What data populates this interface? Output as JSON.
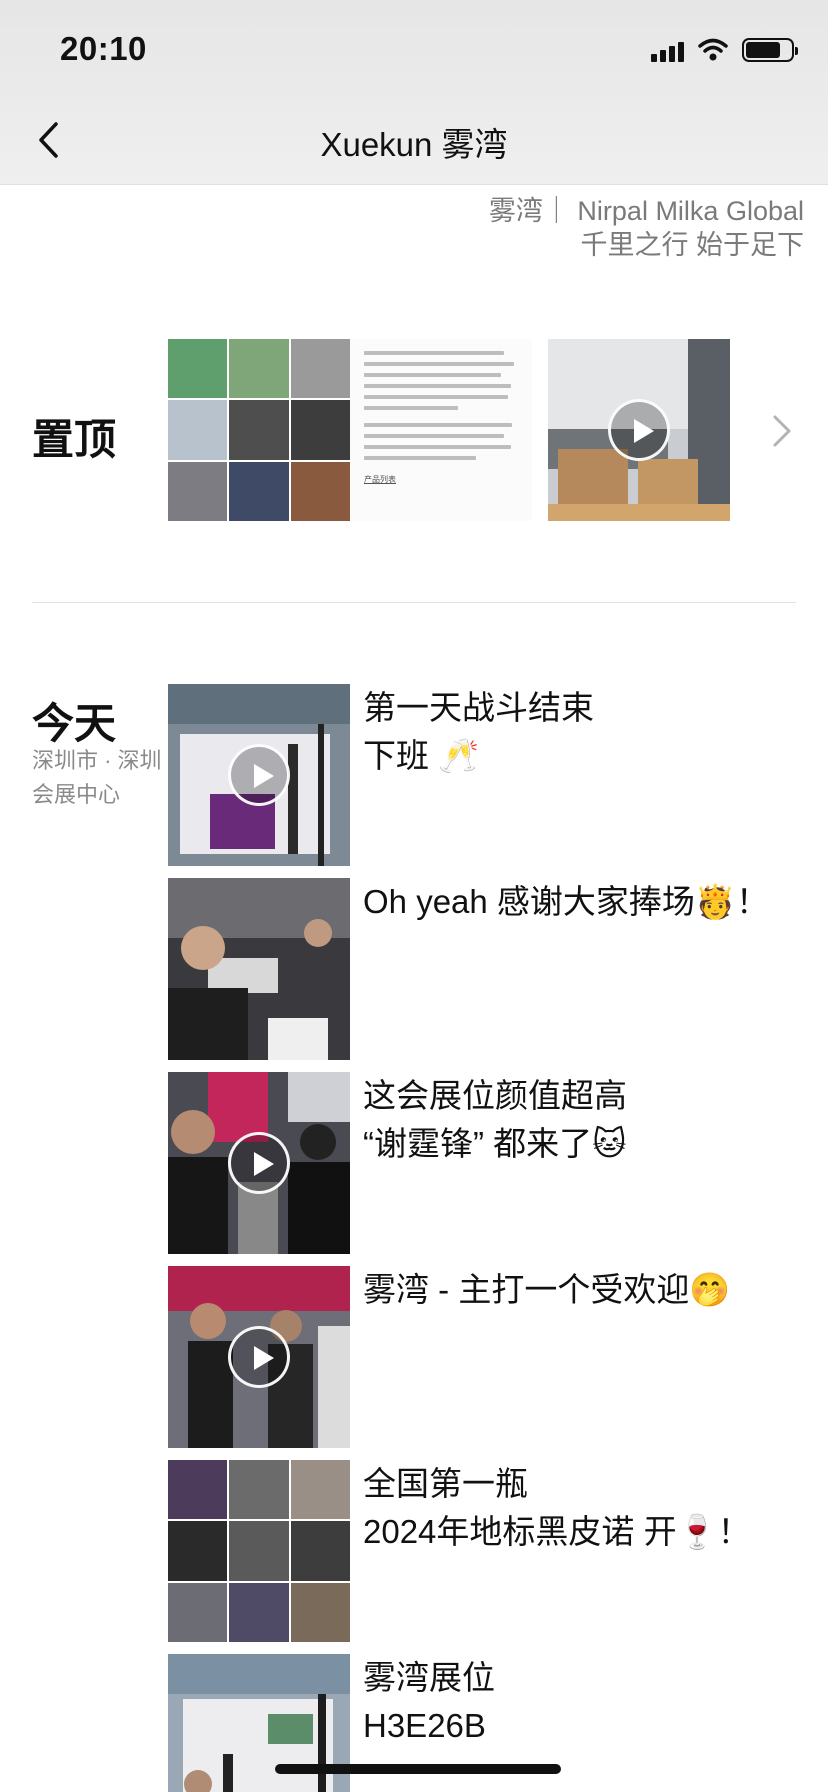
{
  "status_bar": {
    "time": "20:10"
  },
  "nav": {
    "title": "Xuekun 雾湾"
  },
  "signature": {
    "line1": "雾湾｜ Nirpal Milka Global",
    "line2": "千里之行 始于足下"
  },
  "pinned": {
    "label": "置顶",
    "article_link": "产品列表"
  },
  "today": {
    "label": "今天",
    "location": "深圳市 · 深圳会展中心",
    "posts": [
      {
        "caption": "第一天战斗结束\n下班 🥂",
        "type": "video"
      },
      {
        "caption": "Oh yeah 感谢大家捧场🫅！",
        "type": "image"
      },
      {
        "caption": "这会展位颜值超高\n“谢霆锋” 都来了🐱",
        "type": "video"
      },
      {
        "caption": "雾湾 - 主打一个受欢迎🤭",
        "type": "video"
      },
      {
        "caption": "全国第一瓶\n2024年地标黑皮诺 开🍷！",
        "type": "collage"
      },
      {
        "caption": "雾湾展位\nH3E26B",
        "type": "image"
      }
    ]
  },
  "colors": {
    "topbar": "#ececec",
    "secondary_text": "#8a8a8a",
    "divider": "#e2e2e2"
  },
  "icons": [
    "back-chevron-icon",
    "signal-icon",
    "wifi-icon",
    "battery-icon",
    "chevron-right-icon",
    "play-icon"
  ]
}
